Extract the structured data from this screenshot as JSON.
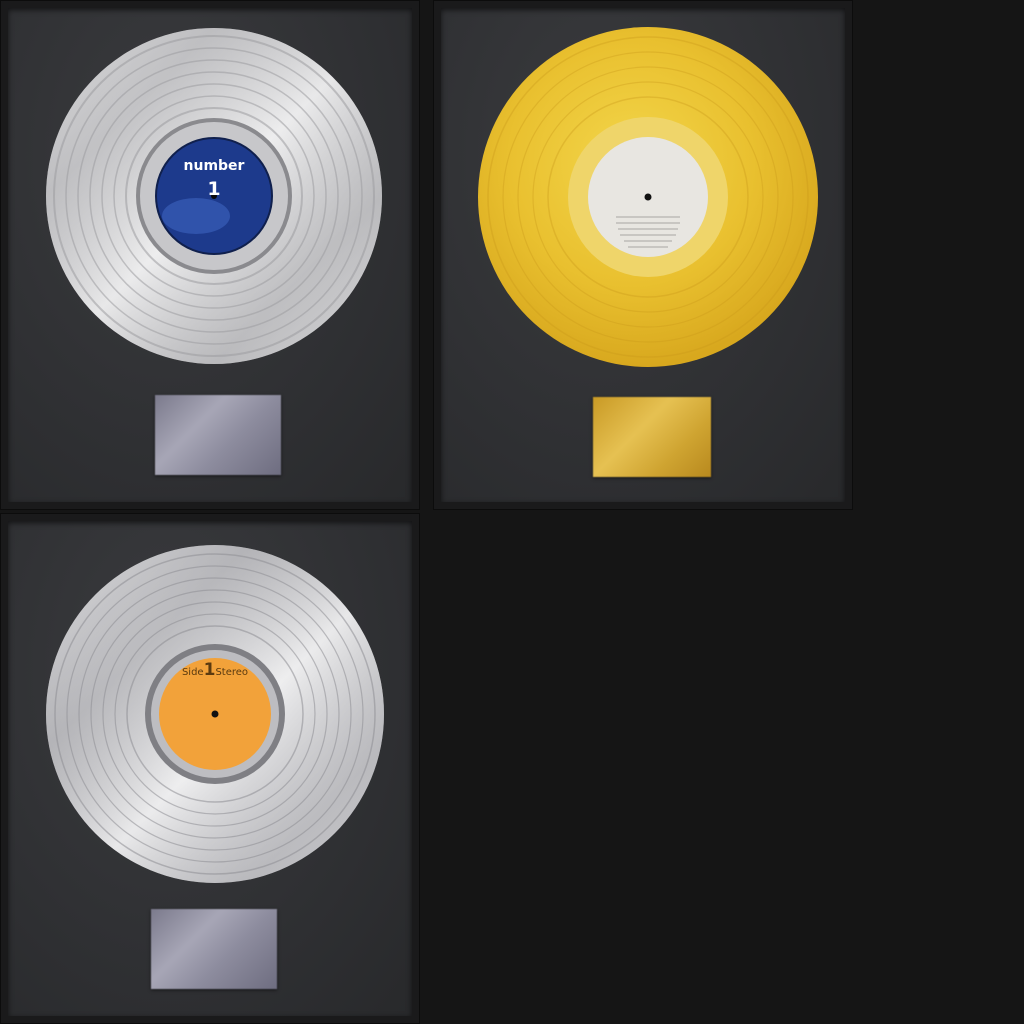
{
  "records": [
    {
      "finish": "platinum",
      "label": {
        "color": "#1d3a8c",
        "top_text": "number",
        "big_text": "1"
      },
      "plaque": {
        "style": "silver"
      }
    },
    {
      "finish": "gold",
      "label": {
        "color": "#e8e6e1"
      },
      "plaque": {
        "style": "gold"
      }
    },
    {
      "finish": "silver",
      "label": {
        "color": "#f2a23a",
        "side_text": "Side",
        "side_number": "1",
        "stereo_text": "Stereo"
      },
      "plaque": {
        "style": "silver"
      }
    }
  ],
  "colors": {
    "background": "#151515",
    "mat": "#2f3033",
    "gold_disc": "#e9c02f",
    "silver_disc": "#d6d6d8"
  }
}
